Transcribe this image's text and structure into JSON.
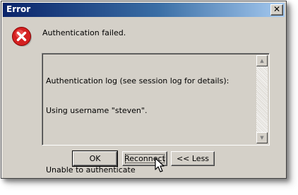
{
  "window": {
    "title": "Error",
    "close_glyph": "✕",
    "icon": "error-icon"
  },
  "message": "Authentication failed.",
  "log": {
    "lines": [
      "Authentication log (see session log for details):",
      "Using username \"steven\".",
      "",
      "Unable to authenticate"
    ],
    "scroll_up_glyph": "▲",
    "scroll_down_glyph": "▼"
  },
  "buttons": {
    "ok": "OK",
    "reconnect": "Reconnect",
    "less": "<< Less"
  },
  "colors": {
    "title_gradient_start": "#0a246a",
    "title_gradient_end": "#a6caf0",
    "dialog_face": "#d4d0c8",
    "error_red": "#d42121"
  }
}
